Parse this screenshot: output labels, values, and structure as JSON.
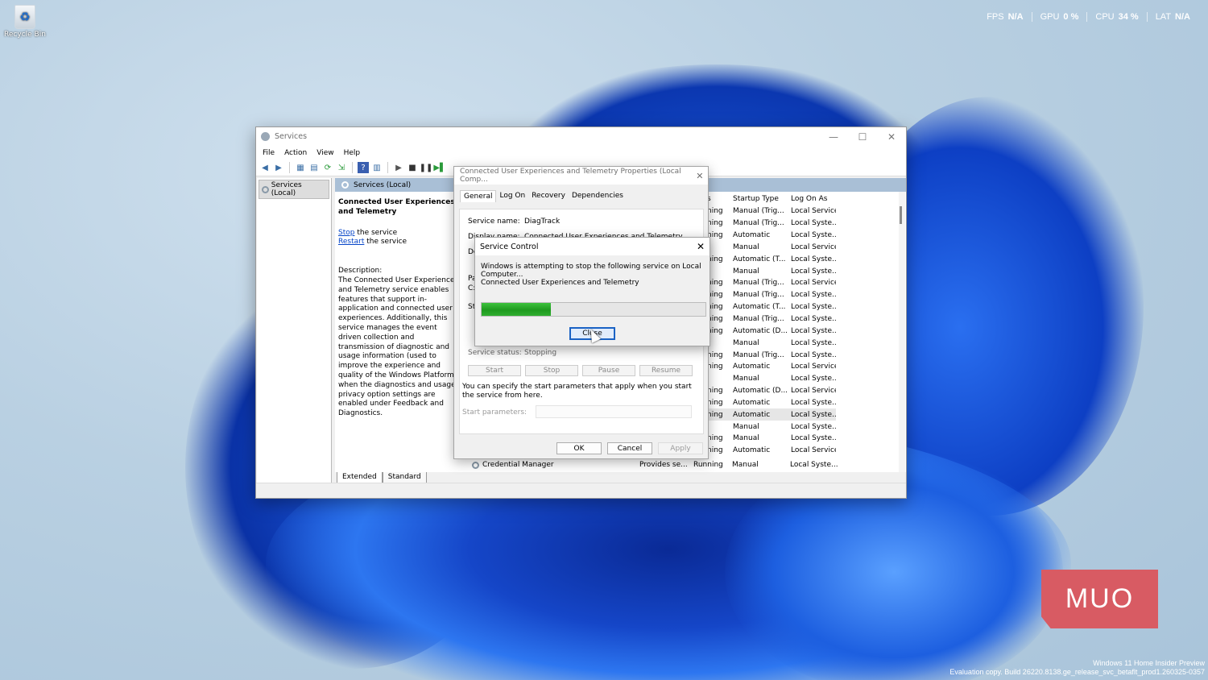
{
  "desktop": {
    "recycle_bin_label": "Recycle Bin",
    "watermark_line1": "Windows 11 Home Insider Preview",
    "watermark_line2": "Evaluation copy. Build 26220.8138.ge_release_svc_betaflt_prod1.260325-0357",
    "logo_text": "MUO"
  },
  "hud": {
    "items": [
      {
        "label": "FPS",
        "value": "N/A"
      },
      {
        "label": "GPU",
        "value": "0 %"
      },
      {
        "label": "CPU",
        "value": "34 %"
      },
      {
        "label": "LAT",
        "value": "N/A"
      }
    ]
  },
  "services_window": {
    "title": "Services",
    "minimize": "—",
    "maximize": "☐",
    "close": "✕",
    "menu": [
      "File",
      "Action",
      "View",
      "Help"
    ],
    "nav_item": "Services (Local)",
    "pane_header": "Services (Local)",
    "detail_title": "Connected User Experiences and Telemetry",
    "stop_link": "Stop",
    "stop_suffix": " the service",
    "restart_link": "Restart",
    "restart_suffix": " the service",
    "description_label": "Description:",
    "description": "The Connected User Experiences and Telemetry service enables features that support in-application and connected user experiences. Additionally, this service manages the event driven collection and transmission of diagnostic and usage information (used to improve the experience and quality of the Windows Platform) when the diagnostics and usage privacy option settings are enabled under Feedback and Diagnostics.",
    "columns": {
      "status": "s",
      "startup": "Startup Type",
      "logon": "Log On As"
    },
    "rows": [
      {
        "status": "ning",
        "startup": "Manual (Trig...",
        "logon": "Local Service"
      },
      {
        "status": "ning",
        "startup": "Manual (Trig...",
        "logon": "Local Syste..."
      },
      {
        "status": "ning",
        "startup": "Automatic",
        "logon": "Local Syste..."
      },
      {
        "status": "",
        "startup": "Manual",
        "logon": "Local Service"
      },
      {
        "status": "ning",
        "startup": "Automatic (T...",
        "logon": "Local Syste..."
      },
      {
        "status": "",
        "startup": "Manual",
        "logon": "Local Syste..."
      },
      {
        "status": "ning",
        "startup": "Manual (Trig...",
        "logon": "Local Service"
      },
      {
        "status": "ning",
        "startup": "Manual (Trig...",
        "logon": "Local Syste..."
      },
      {
        "status": "ning",
        "startup": "Automatic (T...",
        "logon": "Local Syste..."
      },
      {
        "status": "ning",
        "startup": "Manual (Trig...",
        "logon": "Local Syste..."
      },
      {
        "status": "ning",
        "startup": "Automatic (D...",
        "logon": "Local Syste..."
      },
      {
        "status": "",
        "startup": "Manual",
        "logon": "Local Syste..."
      },
      {
        "status": "ning",
        "startup": "Manual (Trig...",
        "logon": "Local Syste..."
      },
      {
        "status": "ning",
        "startup": "Automatic",
        "logon": "Local Service"
      },
      {
        "status": "",
        "startup": "Manual",
        "logon": "Local Syste..."
      },
      {
        "status": "ning",
        "startup": "Automatic (D...",
        "logon": "Local Service"
      },
      {
        "status": "ning",
        "startup": "Automatic",
        "logon": "Local Syste..."
      },
      {
        "status": "ning",
        "startup": "Automatic",
        "logon": "Local Syste..."
      },
      {
        "status": "",
        "startup": "Manual",
        "logon": "Local Syste..."
      },
      {
        "status": "ning",
        "startup": "Manual",
        "logon": "Local Syste..."
      },
      {
        "status": "ning",
        "startup": "Automatic",
        "logon": "Local Service"
      }
    ],
    "last_row": {
      "name": "Credential Manager",
      "description": "Provides se...",
      "status": "Running",
      "startup": "Manual",
      "logon": "Local Syste..."
    },
    "tabs": [
      "Extended",
      "Standard"
    ]
  },
  "properties_dialog": {
    "title": "Connected User Experiences and Telemetry Properties (Local Comp...",
    "close": "✕",
    "tabs": [
      "General",
      "Log On",
      "Recovery",
      "Dependencies"
    ],
    "service_name_label": "Service name:",
    "service_name": "DiagTrack",
    "display_name_label": "Display name:",
    "display_name": "Connected User Experiences and Telemetry",
    "partial_labels": [
      "De",
      "Pa",
      "C:",
      "St"
    ],
    "service_status_label": "Service status:",
    "service_status": "Stopping",
    "buttons": [
      "Start",
      "Stop",
      "Pause",
      "Resume"
    ],
    "note": "You can specify the start parameters that apply when you start the service from here.",
    "start_params_label": "Start parameters:",
    "ok": "OK",
    "cancel": "Cancel",
    "apply": "Apply"
  },
  "service_control": {
    "title": "Service Control",
    "close": "✕",
    "message": "Windows is attempting to stop the following service on Local Computer...",
    "service_name": "Connected User Experiences and Telemetry",
    "progress": 0.31,
    "close_button": "Close",
    "progress_color": "#2fae2f"
  }
}
